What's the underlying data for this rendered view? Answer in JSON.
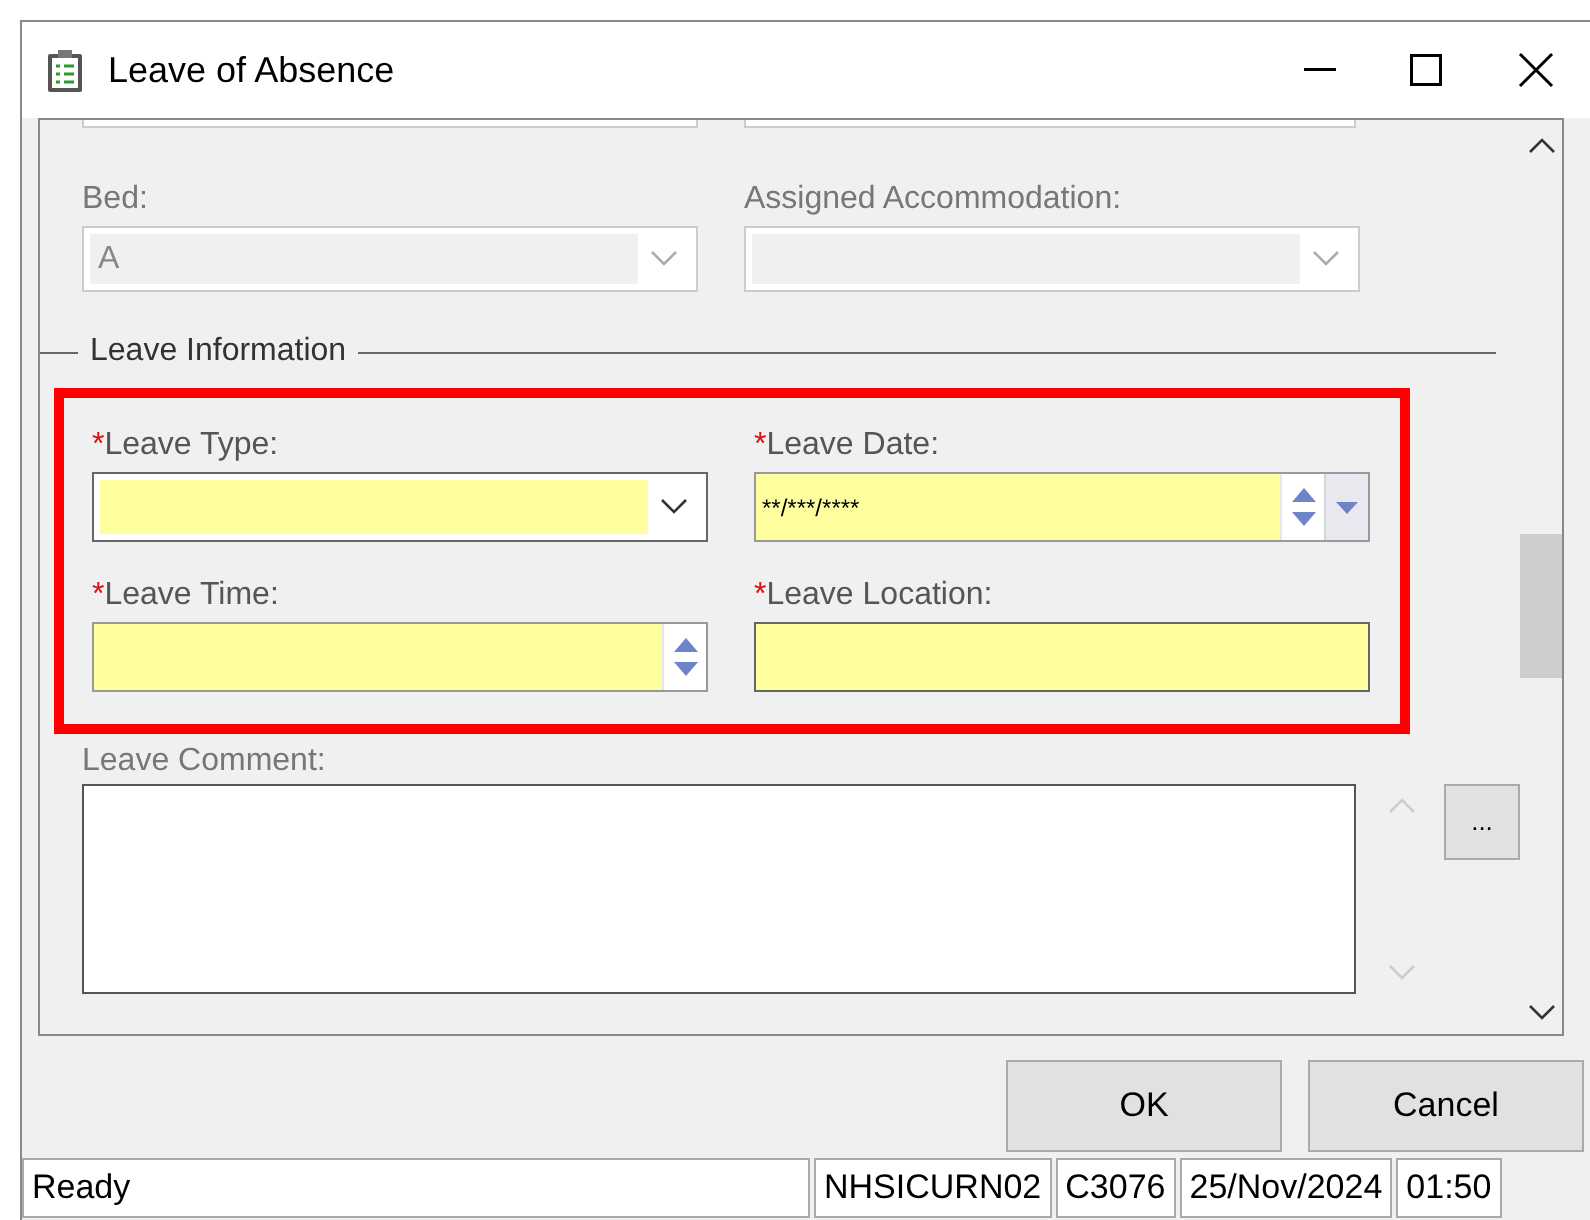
{
  "window": {
    "title": "Leave of Absence"
  },
  "upper_fields": [
    {
      "label": "Bed:",
      "value": "A",
      "disabled": true
    },
    {
      "label": "Assigned Accommodation:",
      "disabled": true
    }
  ],
  "leave_information": {
    "title": "Leave Information",
    "highlighted": true,
    "fields": [
      {
        "kind": "combo",
        "required_mark": "*",
        "label": "Leave Type:"
      },
      {
        "kind": "date",
        "required_mark": "*",
        "label": "Leave Date:",
        "value": "**/***/****"
      },
      {
        "kind": "time",
        "required_mark": "*",
        "label": "Leave Time:"
      },
      {
        "kind": "text",
        "required_mark": "*",
        "label": "Leave Location:"
      }
    ]
  },
  "comment": {
    "label": "Leave Comment:",
    "browse_button": "..."
  },
  "buttons": [
    "OK",
    "Cancel"
  ],
  "status_bar": [
    "Ready",
    "NHSICURN02",
    "C3076",
    "25/Nov/2024",
    "01:50"
  ]
}
